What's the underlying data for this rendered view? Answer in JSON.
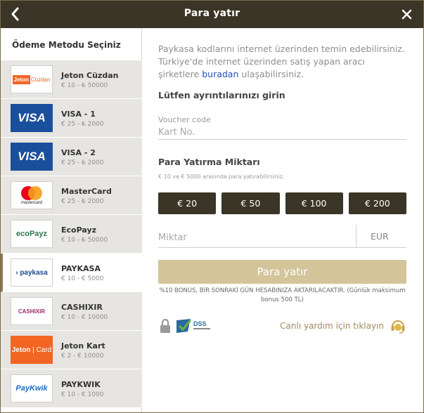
{
  "header": {
    "title": "Para yatır",
    "back_icon": "chevron-left-icon",
    "close_icon": "close-icon"
  },
  "sidebar": {
    "heading": "Ödeme Metodu Seçiniz",
    "methods": [
      {
        "name": "Jeton Cüzdan",
        "range": "€ 10 - ₺ 50000",
        "logo": "jeton-cuzdan-logo",
        "logo_text_1": "Jeton",
        "logo_text_2": "Cüzdan",
        "active": false
      },
      {
        "name": "VISA - 1",
        "range": "€ 25 - ₺ 2000",
        "logo": "visa-logo",
        "logo_text_1": "VISA",
        "active": false
      },
      {
        "name": "VISA - 2",
        "range": "€ 25 - ₺ 2000",
        "logo": "visa-logo",
        "logo_text_1": "VISA",
        "active": false
      },
      {
        "name": "MasterCard",
        "range": "€ 25 - ₺ 2000",
        "logo": "mastercard-logo",
        "logo_text_1": "mastercard",
        "active": false
      },
      {
        "name": "EcoPayz",
        "range": "€ 10 - ₺ 50000",
        "logo": "ecopayz-logo",
        "logo_text_1": "ecoPayz",
        "active": false
      },
      {
        "name": "PAYKASA",
        "range": "€ 10 - € 5000",
        "logo": "paykasa-logo",
        "logo_text_1": "paykasa",
        "active": true
      },
      {
        "name": "CASHIXIR",
        "range": "€ 10 - € 10000",
        "logo": "cashixir-logo",
        "logo_text_1": "CASHIXIR",
        "active": false
      },
      {
        "name": "Jeton Kart",
        "range": "€ 2 - € 10000",
        "logo": "jeton-kart-logo",
        "logo_text_1": "Jeton",
        "logo_text_2": "Card",
        "active": false
      },
      {
        "name": "PAYKWIK",
        "range": "€ 10 - € 1000",
        "logo": "paykwik-logo",
        "logo_text_1": "PayKwik",
        "active": false
      }
    ]
  },
  "main": {
    "info_text_1": "Paykasa kodlarını internet üzerinden temin edebilirsiniz. Türkiye'de internet üzerinden satış yapan aracı şirketlere",
    "info_link": "buradan",
    "info_text_2": "ulaşabilirsiniz.",
    "details_title": "Lütfen ayrıntılarınızı girin",
    "voucher_label": "Voucher code",
    "voucher_placeholder": "Kart No.",
    "amount_title": "Para Yatırma Miktarı",
    "amount_note": "€ 10 ve € 5000 arasında para yatırabilirsiniz.",
    "amount_buttons": [
      "€ 20",
      "€ 50",
      "€ 100",
      "€ 200"
    ],
    "amount_placeholder": "Miktar",
    "currency": "EUR",
    "submit_label": "Para yatır",
    "bonus_text": "%10 BONUS, BİR SONRAKİ GÜN HESABINIZA AKTARILACAKTIR. (Günlük maksimum bonus 500 TL)",
    "support_label": "Canlı yardım için tıklayın",
    "pci_logo_text": "DSS",
    "icons": [
      "lock-icon",
      "pci-dss-icon",
      "headset-icon"
    ]
  },
  "colors": {
    "header_bg": "#3a3526",
    "accent_gold": "#d3c49a",
    "amount_btn_bg": "#3a3526",
    "link_blue": "#2050b8",
    "support_text": "#a08a5a"
  }
}
